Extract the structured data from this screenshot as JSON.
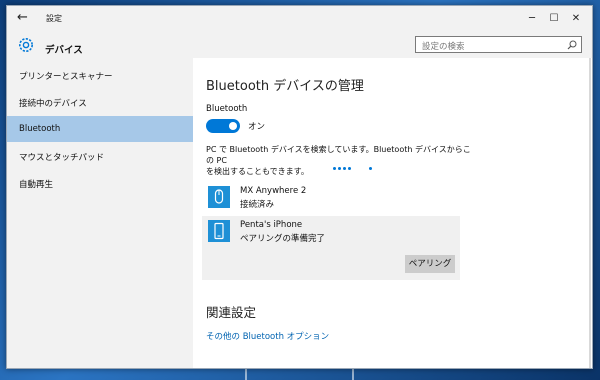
{
  "window": {
    "title": "設定",
    "app_title": "デバイス",
    "controls": {
      "minimize": "─",
      "maximize": "☐",
      "close": "✕"
    }
  },
  "search": {
    "placeholder": "設定の検索"
  },
  "sidebar": {
    "items": [
      {
        "label": "プリンターとスキャナー",
        "active": false
      },
      {
        "label": "接続中のデバイス",
        "active": false
      },
      {
        "label": "Bluetooth",
        "active": true
      },
      {
        "label": "マウスとタッチパッド",
        "active": false
      },
      {
        "label": "自動再生",
        "active": false
      }
    ]
  },
  "main": {
    "heading": "Bluetooth デバイスの管理",
    "bluetooth_label": "Bluetooth",
    "toggle_state": "オン",
    "description_line1": "PC で Bluetooth デバイスを検索しています。Bluetooth デバイスからこの PC",
    "description_line2": "を検出することもできます。",
    "devices": [
      {
        "name": "MX Anywhere 2",
        "status": "接続済み",
        "icon": "mouse-icon"
      },
      {
        "name": "Penta's iPhone",
        "status": "ペアリングの準備完了",
        "icon": "phone-icon"
      }
    ],
    "pair_button": "ペアリング",
    "related_heading": "関連設定",
    "related_link": "その他の Bluetooth オプション"
  },
  "colors": {
    "accent": "#0078d7",
    "selected_nav": "#a6c8e8",
    "link": "#0063b1"
  }
}
